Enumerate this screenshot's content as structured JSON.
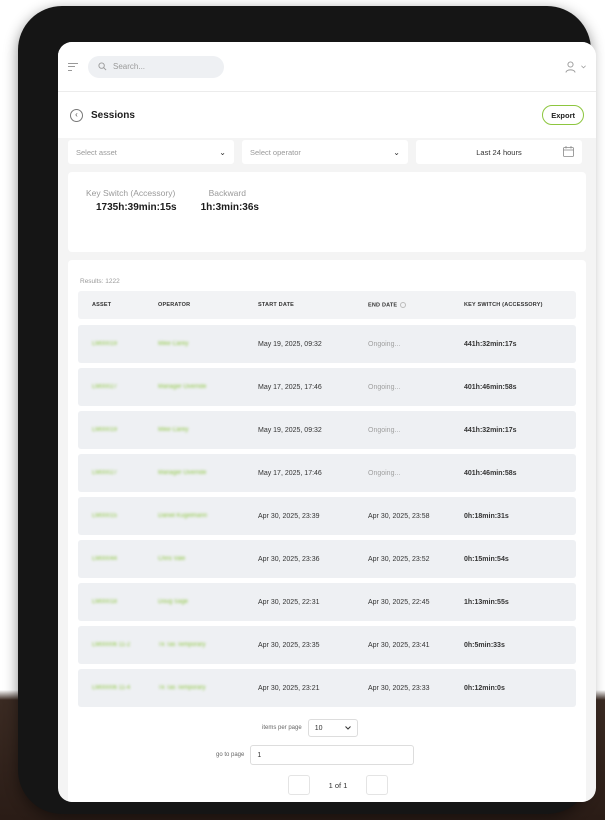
{
  "header": {
    "search_placeholder": "Search...",
    "icons": [
      "menu-icon",
      "search-icon",
      "user-icon",
      "chevron-down-icon"
    ]
  },
  "page": {
    "title": "Sessions",
    "export_label": "Export"
  },
  "filters": {
    "asset_placeholder": "Select asset",
    "operator_placeholder": "Select operator",
    "time_range": "Last 24 hours"
  },
  "totals": [
    {
      "label": "Key Switch (Accessory)",
      "value": "1735h:39min:15s"
    },
    {
      "label": "Backward",
      "value": "1h:3min:36s"
    }
  ],
  "results": {
    "count_label": "Results: 1222",
    "columns": [
      "ASSET",
      "OPERATOR",
      "START DATE",
      "END DATE",
      "KEY SWITCH (ACCESSORY)"
    ],
    "rows": [
      {
        "asset": "LM00019",
        "operator": "Mike Carey",
        "start": "May 19, 2025, 09:32",
        "end": "Ongoing...",
        "key_switch": "441h:32min:17s"
      },
      {
        "asset": "LM00027",
        "operator": "Manager Override",
        "start": "May 17, 2025, 17:46",
        "end": "Ongoing...",
        "key_switch": "401h:46min:58s"
      },
      {
        "asset": "LM00019",
        "operator": "Mike Carey",
        "start": "May 19, 2025, 09:32",
        "end": "Ongoing...",
        "key_switch": "441h:32min:17s"
      },
      {
        "asset": "LM00027",
        "operator": "Manager Override",
        "start": "May 17, 2025, 17:46",
        "end": "Ongoing...",
        "key_switch": "401h:46min:58s"
      },
      {
        "asset": "LM00015",
        "operator": "Daniel Kugelmann",
        "start": "Apr 30, 2025, 23:39",
        "end": "Apr 30, 2025, 23:58",
        "key_switch": "0h:18min:31s"
      },
      {
        "asset": "LM00044",
        "operator": "Chris Vale",
        "start": "Apr 30, 2025, 23:36",
        "end": "Apr 30, 2025, 23:52",
        "key_switch": "0h:15min:54s"
      },
      {
        "asset": "LM00018",
        "operator": "Doug Sage",
        "start": "Apr 30, 2025, 22:31",
        "end": "Apr 30, 2025, 22:45",
        "key_switch": "1h:13min:55s"
      },
      {
        "asset": "LM00006 11-2",
        "operator": "Tk Tas Temporary",
        "start": "Apr 30, 2025, 23:35",
        "end": "Apr 30, 2025, 23:41",
        "key_switch": "0h:5min:33s"
      },
      {
        "asset": "LM00006 11-4",
        "operator": "Tk Tas Temporary",
        "start": "Apr 30, 2025, 23:21",
        "end": "Apr 30, 2025, 23:33",
        "key_switch": "0h:12min:0s"
      }
    ]
  },
  "pagination": {
    "items_per_page_label": "items per page",
    "items_per_page_value": "10",
    "go_to_page_label": "go to page",
    "go_to_page_value": "1",
    "page_info": "1 of 1"
  },
  "colors": {
    "accent": "#8dc63f",
    "row_bg": "#eef0f3",
    "screen_bg": "#f4f4f4"
  }
}
